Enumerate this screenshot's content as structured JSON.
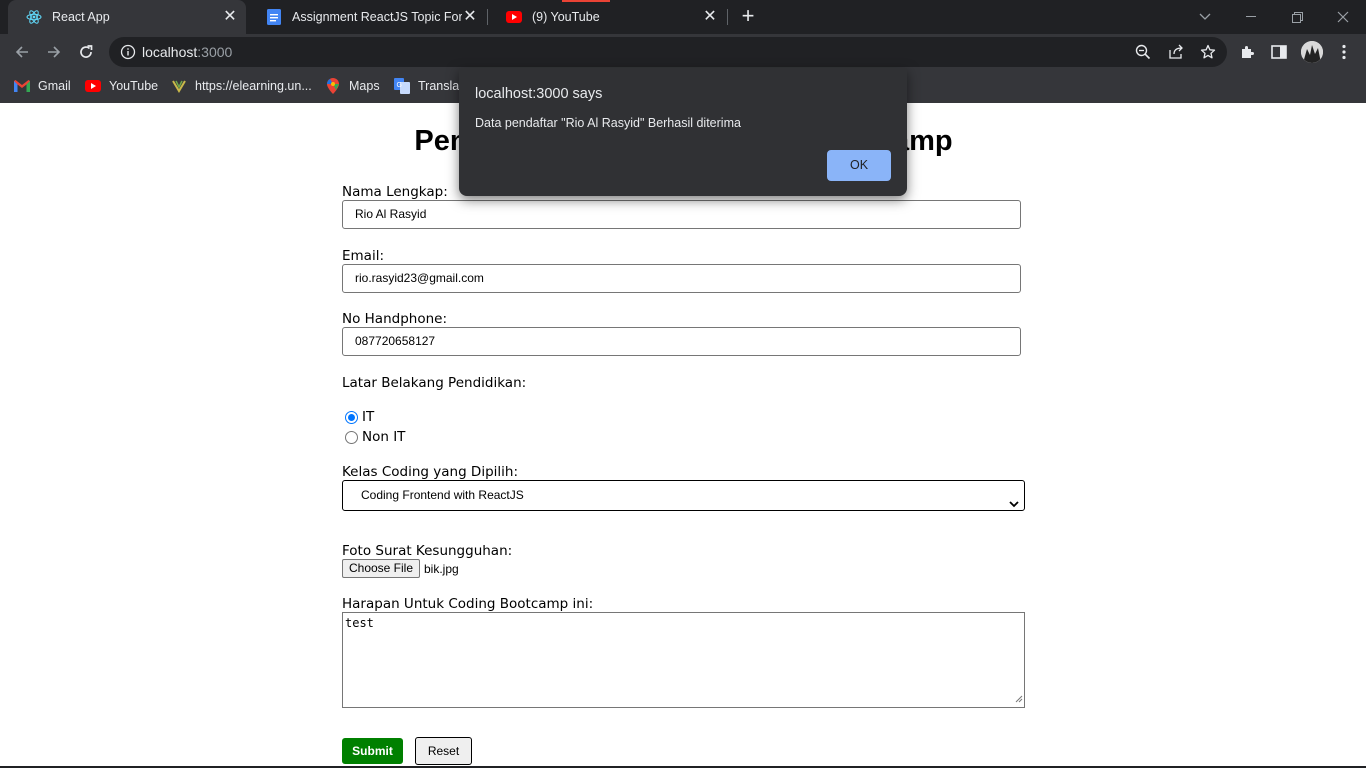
{
  "browser": {
    "tabs": [
      {
        "title": "React App",
        "icon": "react-icon",
        "active": true
      },
      {
        "title": "Assignment ReactJS Topic Form -",
        "icon": "google-docs-icon",
        "active": false
      },
      {
        "title": "(9) YouTube",
        "icon": "youtube-icon",
        "active": false
      }
    ],
    "url_host": "localhost",
    "url_port": ":3000",
    "bookmarks": [
      {
        "label": "Gmail",
        "icon": "gmail-icon"
      },
      {
        "label": "YouTube",
        "icon": "youtube-icon"
      },
      {
        "label": "https://elearning.un...",
        "icon": "elearning-icon"
      },
      {
        "label": "Maps",
        "icon": "maps-icon"
      },
      {
        "label": "Translat",
        "icon": "translate-icon"
      }
    ]
  },
  "form": {
    "title": "Pendaftaran Peserta Coding Bootcamp",
    "name_label": "Nama Lengkap:",
    "name_value": "Rio Al Rasyid",
    "email_label": "Email:",
    "email_value": "rio.rasyid23@gmail.com",
    "phone_label": "No Handphone:",
    "phone_value": "087720658127",
    "education_label": "Latar Belakang Pendidikan:",
    "education_options": [
      {
        "label": "IT",
        "checked": true
      },
      {
        "label": "Non IT",
        "checked": false
      }
    ],
    "class_label": "Kelas Coding yang Dipilih:",
    "class_value": "Coding Frontend with ReactJS",
    "photo_label": "Foto Surat Kesungguhan:",
    "choose_file_label": "Choose File",
    "file_name": "bik.jpg",
    "hope_label": "Harapan Untuk Coding Bootcamp ini:",
    "hope_value": "test",
    "submit_label": "Submit",
    "reset_label": "Reset"
  },
  "dialog": {
    "title": "localhost:3000 says",
    "message": "Data pendaftar \"Rio Al Rasyid\" Berhasil diterima",
    "ok_label": "OK"
  },
  "colors": {
    "submit_bg": "#008000",
    "dialog_bg": "#303134",
    "ok_bg": "#8ab4f8",
    "chrome_bg": "#35363a"
  }
}
